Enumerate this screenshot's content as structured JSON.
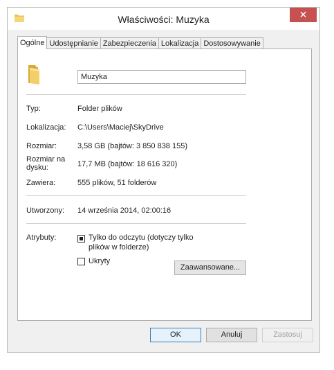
{
  "window": {
    "title": "Właściwości: Muzyka",
    "close_glyph": "✕"
  },
  "tabs": [
    {
      "label": "Ogólne"
    },
    {
      "label": "Udostępnianie"
    },
    {
      "label": "Zabezpieczenia"
    },
    {
      "label": "Lokalizacja"
    },
    {
      "label": "Dostosowywanie"
    }
  ],
  "general": {
    "name_value": "Muzyka",
    "type_label": "Typ:",
    "type_value": "Folder plików",
    "location_label": "Lokalizacja:",
    "location_value": "C:\\Users\\Maciej\\SkyDrive",
    "size_label": "Rozmiar:",
    "size_value": "3,58 GB (bajtów: 3 850 838 155)",
    "disk_size_label_1": "Rozmiar na",
    "disk_size_label_2": "dysku:",
    "disk_size_value": "17,7 MB (bajtów: 18 616 320)",
    "contains_label": "Zawiera:",
    "contains_value": "555 plików, 51 folderów",
    "created_label": "Utworzony:",
    "created_value": "14 września 2014, 02:00:16",
    "attributes_label": "Atrybuty:",
    "readonly_label_1": "Tylko do odczytu (dotyczy tylko",
    "readonly_label_2": "plików w folderze)",
    "hidden_label": "Ukryty",
    "advanced_button": "Zaawansowane..."
  },
  "buttons": {
    "ok": "OK",
    "cancel": "Anuluj",
    "apply": "Zastosuj"
  },
  "colors": {
    "close": "#c75050",
    "folder": "#e8c25a"
  }
}
